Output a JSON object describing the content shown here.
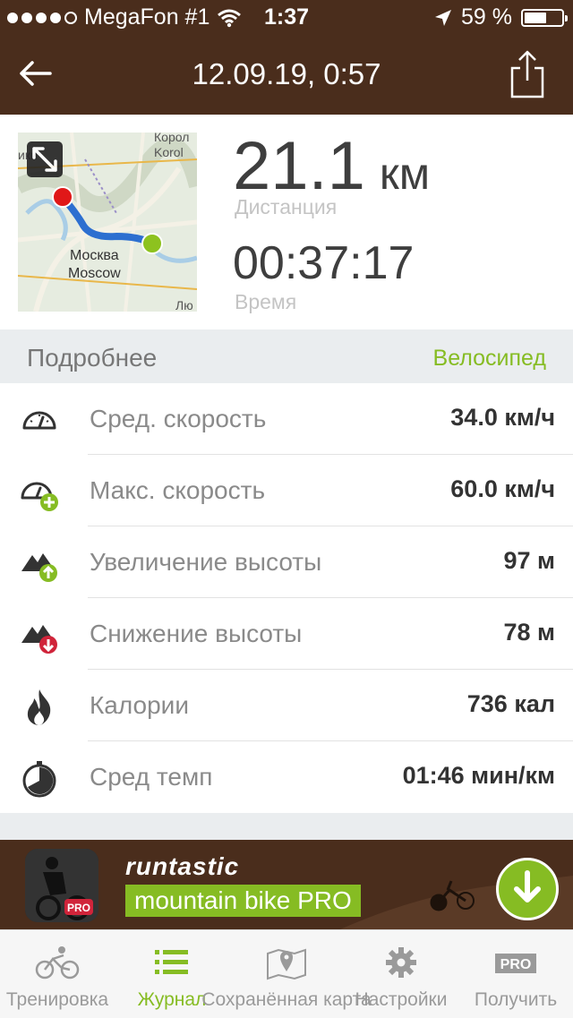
{
  "status": {
    "carrier": "MegaFon #1",
    "time": "1:37",
    "battery": "59 %",
    "battery_level": 0.59
  },
  "nav": {
    "title": "12.09.19, 0:57"
  },
  "map": {
    "label_top_1": "Корол",
    "label_top_2": "Korol",
    "label_left": "ики",
    "city_ru": "Москва",
    "city_en": "Moscow",
    "label_bottom": "Лю"
  },
  "summary": {
    "distance_value": "21.1",
    "distance_unit": "км",
    "distance_label": "Дистанция",
    "time_value": "00:37:17",
    "time_label": "Время"
  },
  "details": {
    "header": "Подробнее",
    "sport": "Велосипед"
  },
  "stats": [
    {
      "label": "Сред. скорость",
      "value": "34.0 км/ч"
    },
    {
      "label": "Макс. скорость",
      "value": "60.0 км/ч"
    },
    {
      "label": "Увеличение высоты",
      "value": "97 м"
    },
    {
      "label": "Снижение высоты",
      "value": "78 м"
    },
    {
      "label": "Калории",
      "value": "736 кал"
    },
    {
      "label": "Сред темп",
      "value": "01:46 мин/км"
    }
  ],
  "banner": {
    "brand": "runtastic",
    "product": "mountain bike PRO",
    "badge": "PRO"
  },
  "tabs": [
    {
      "label": "Тренировка",
      "icon": "bike-icon"
    },
    {
      "label": "Журнал",
      "icon": "list-icon"
    },
    {
      "label": "Сохранённая карта",
      "icon": "map-pin-icon"
    },
    {
      "label": "Настройки",
      "icon": "gear-icon"
    },
    {
      "label": "Получить",
      "icon": "pro-icon",
      "badge": "PRO"
    }
  ],
  "colors": {
    "brown": "#4a2d1c",
    "accent_green": "#86bc23",
    "descent_red": "#d0243a"
  }
}
